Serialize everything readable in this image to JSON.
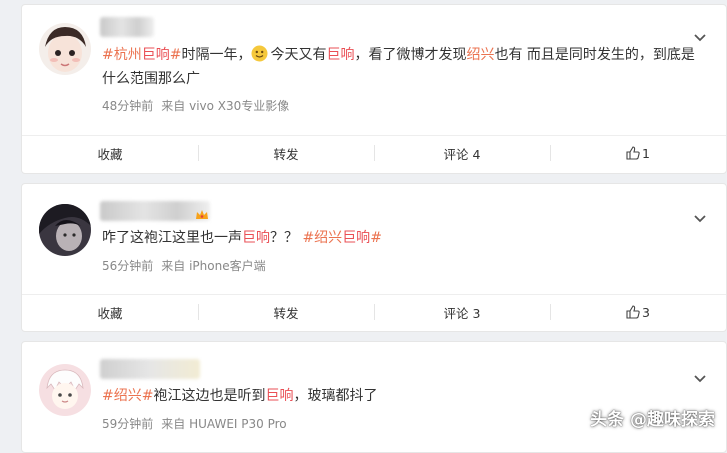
{
  "posts": [
    {
      "segments": [
        {
          "t": "#杭州",
          "c": "tag"
        },
        {
          "t": "巨响",
          "c": "hl"
        },
        {
          "t": "#",
          "c": "tag"
        },
        {
          "t": "时隔一年，",
          "c": ""
        },
        {
          "t": "今天又有",
          "c": ""
        },
        {
          "t": "巨响",
          "c": "hl"
        },
        {
          "t": "，看了微博才发现",
          "c": ""
        },
        {
          "t": "绍兴",
          "c": "tag"
        },
        {
          "t": "也有 而且是同时发生的，到底是什么范围那么广",
          "c": ""
        }
      ],
      "time": "48分钟前",
      "source": "来自 vivo X30专业影像",
      "actions": {
        "fav": "收藏",
        "repost": "转发",
        "comment": "评论 4",
        "like": "1"
      }
    },
    {
      "segments": [
        {
          "t": "咋了这袍江这里也一声",
          "c": ""
        },
        {
          "t": "巨响",
          "c": "hl"
        },
        {
          "t": "？？ ",
          "c": ""
        },
        {
          "t": "#绍兴",
          "c": "tag"
        },
        {
          "t": "巨响",
          "c": "hl"
        },
        {
          "t": "#",
          "c": "tag"
        }
      ],
      "time": "56分钟前",
      "source": "来自 iPhone客户端",
      "actions": {
        "fav": "收藏",
        "repost": "转发",
        "comment": "评论 3",
        "like": "3"
      }
    },
    {
      "segments": [
        {
          "t": "#绍兴#",
          "c": "tag"
        },
        {
          "t": "袍江这边也是听到",
          "c": ""
        },
        {
          "t": "巨响",
          "c": "hl"
        },
        {
          "t": "，玻璃都抖了",
          "c": ""
        }
      ],
      "time": "59分钟前",
      "source": "来自 HUAWEI P30 Pro"
    }
  ],
  "watermark": "头条 @趣味探索",
  "icons": {
    "expand": "chevron-down-icon",
    "like": "thumbs-up-icon",
    "emoji": "smile-emoji-icon"
  },
  "colors": {
    "topic": "#eb7350",
    "highlight": "#ea4f55"
  }
}
